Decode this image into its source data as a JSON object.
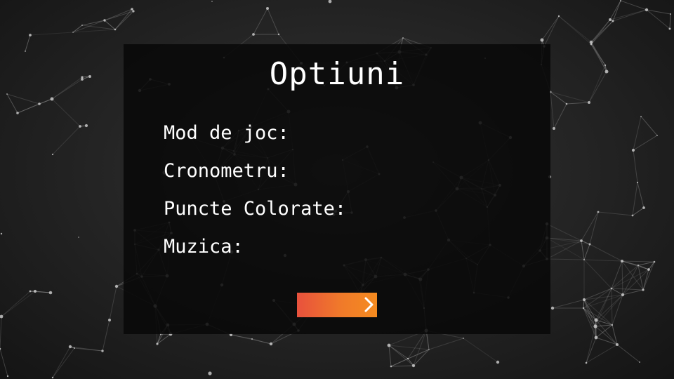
{
  "title": "Optiuni",
  "options": [
    {
      "label": "Mod de joc:"
    },
    {
      "label": "Cronometru:"
    },
    {
      "label": "Puncte Colorate:"
    },
    {
      "label": "Muzica:"
    }
  ],
  "next_button": {
    "icon": "chevron-right-icon",
    "gradient_start": "#e8513d",
    "gradient_end": "#f58b1f"
  },
  "colors": {
    "background": "#1e1e1e",
    "panel": "#0a0a0a",
    "text": "#ffffff",
    "network_lines": "#8a8a8a"
  },
  "background_style": "plexus-network"
}
